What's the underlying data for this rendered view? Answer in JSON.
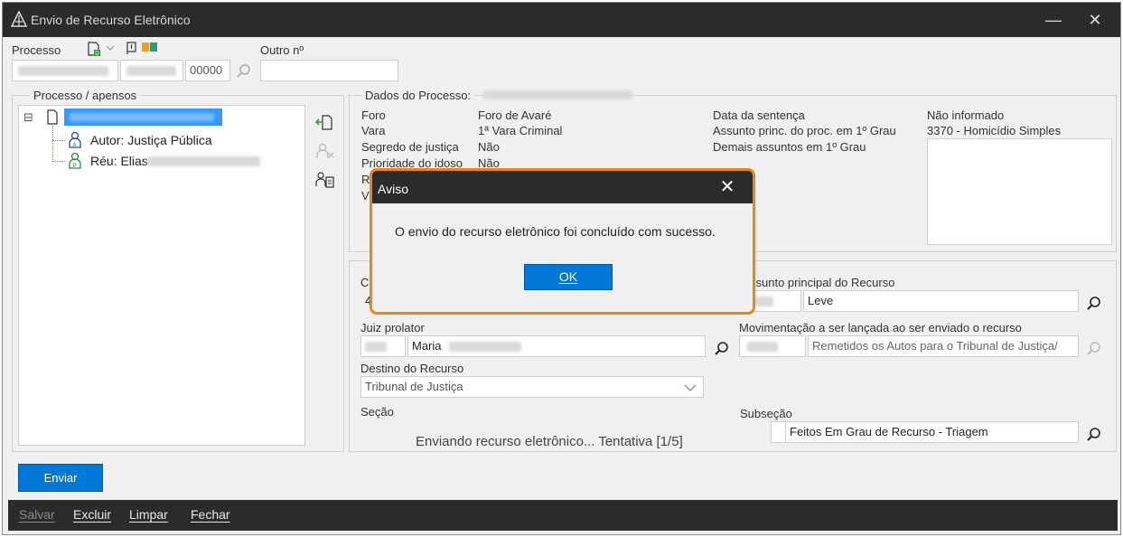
{
  "window": {
    "title": "Envio de Recurso Eletrônico",
    "minimize": "—",
    "close": "✕"
  },
  "top": {
    "processo_label": "Processo",
    "outro_label": "Outro nº",
    "field_number": "00000",
    "outro_value": ""
  },
  "tree_panel": {
    "legend": "Processo / apensos",
    "expander": "⊟",
    "items": [
      {
        "label": "Autor: Justiça Pública"
      },
      {
        "label": "Réu: Elias"
      }
    ]
  },
  "dados": {
    "legend": "Dados do Processo:",
    "rows_left": [
      {
        "label": "Foro",
        "value": "Foro de Avaré"
      },
      {
        "label": "Vara",
        "value": "1ª Vara Criminal"
      },
      {
        "label": "Segredo de justiça",
        "value": "Não"
      },
      {
        "label": "Prioridade do idoso",
        "value": "Não"
      }
    ],
    "partial_r": "R",
    "partial_v": "V",
    "rows_right": [
      {
        "label": "Data da sentença",
        "value": "Não informado"
      },
      {
        "label": "Assunto princ. do proc. em 1º Grau",
        "value": "3370 - Homicídio Simples"
      },
      {
        "label": "Demais assuntos em 1º Grau",
        "value": ""
      }
    ]
  },
  "form": {
    "partial_c": "C",
    "partial_4": "4",
    "assunto_label": "ssunto principal do Recurso",
    "assunto_value": "Leve",
    "juiz_label": "Juiz prolator",
    "juiz_value": "Maria",
    "movimentacao_label": "Movimentação a ser lançada ao ser enviado o recurso",
    "movimentacao_value": "Remetidos os Autos para o Tribunal de Justiça/",
    "destino_label": "Destino do Recurso",
    "destino_value": "Tribunal de Justiça",
    "secao_label": "Seção",
    "subsecao_label": "Subseção",
    "subsecao_value": "Feitos Em Grau de Recurso - Triagem",
    "status_text": "Enviando recurso eletrônico... Tentativa [1/5]"
  },
  "actions": {
    "enviar": "Enviar"
  },
  "footer": {
    "salvar": "Salvar",
    "excluir": "Excluir",
    "limpar": "Limpar",
    "fechar": "Fechar"
  },
  "dialog": {
    "title": "Aviso",
    "message": "O envio do recurso eletrônico foi concluído com sucesso.",
    "ok": "OK",
    "close": "✕"
  },
  "colors": {
    "accent": "#0078d7",
    "highlight_border": "#e8861e",
    "titlebar": "#2b2b2b"
  }
}
